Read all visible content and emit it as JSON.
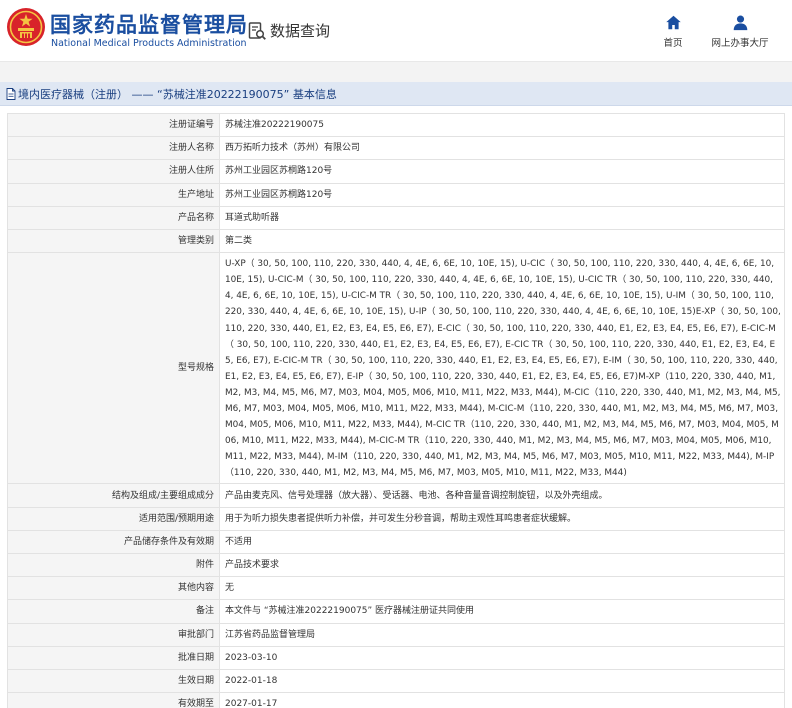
{
  "header": {
    "logo_cn": "国家药品监督管理局",
    "logo_en": "National Medical Products Administration",
    "emblem_icon": "national-emblem-icon",
    "query_label": "数据查询",
    "query_icon": "document-search-icon",
    "nav": [
      {
        "label": "首页",
        "icon": "home-icon"
      },
      {
        "label": "网上办事大厅",
        "icon": "user-icon"
      }
    ]
  },
  "title_bar": {
    "icon": "document-icon",
    "text": "境内医疗器械（注册） —— “苏械注准20222190075” 基本信息"
  },
  "colors": {
    "brand_blue": "#1a4ea0",
    "emblem_red": "#d8232a",
    "title_bar_bg": "#dfe7f3",
    "label_bg": "#f5f5f5"
  },
  "rows": [
    {
      "label": "注册证编号",
      "value": "苏械注准20222190075"
    },
    {
      "label": "注册人名称",
      "value": "西万拓听力技术（苏州）有限公司"
    },
    {
      "label": "注册人住所",
      "value": "苏州工业园区苏桐路120号"
    },
    {
      "label": "生产地址",
      "value": "苏州工业园区苏桐路120号"
    },
    {
      "label": "产品名称",
      "value": "耳道式助听器"
    },
    {
      "label": "管理类别",
      "value": "第二类"
    },
    {
      "label": "型号规格",
      "value": "U-XP（ 30, 50, 100, 110, 220, 330, 440, 4, 4E, 6, 6E, 10, 10E, 15), U-CIC（ 30, 50, 100, 110, 220, 330, 440, 4, 4E, 6, 6E, 10, 10E, 15), U-CIC-M（ 30, 50, 100, 110, 220, 330, 440, 4, 4E, 6, 6E, 10, 10E, 15), U-CIC TR（ 30, 50, 100, 110, 220, 330, 440, 4, 4E, 6, 6E, 10, 10E, 15), U-CIC-M TR（ 30, 50, 100, 110, 220, 330, 440, 4, 4E, 6, 6E, 10, 10E, 15), U-IM（ 30, 50, 100, 110, 220, 330, 440, 4, 4E, 6, 6E, 10, 10E, 15), U-IP（ 30, 50, 100, 110, 220, 330, 440, 4, 4E, 6, 6E, 10, 10E, 15)E-XP（ 30, 50, 100, 110, 220, 330, 440, E1, E2, E3, E4, E5, E6, E7), E-CIC（ 30, 50, 100, 110, 220, 330, 440, E1, E2, E3, E4, E5, E6, E7), E-CIC-M（ 30, 50, 100, 110, 220, 330, 440, E1, E2, E3, E4, E5, E6, E7), E-CIC TR（ 30, 50, 100, 110, 220, 330, 440, E1, E2, E3, E4, E5, E6, E7), E-CIC-M TR（ 30, 50, 100, 110, 220, 330, 440, E1, E2, E3, E4, E5, E6, E7), E-IM（ 30, 50, 100, 110, 220, 330, 440, E1, E2, E3, E4, E5, E6, E7), E-IP（ 30, 50, 100, 110, 220, 330, 440, E1, E2, E3, E4, E5, E6, E7)M-XP（110, 220, 330, 440, M1, M2, M3, M4, M5, M6, M7, M03, M04, M05, M06, M10, M11, M22, M33, M44), M-CIC（110, 220, 330, 440, M1, M2, M3, M4, M5, M6, M7, M03, M04, M05, M06, M10, M11, M22, M33, M44), M-CIC-M（110, 220, 330, 440, M1, M2, M3, M4, M5, M6, M7, M03, M04, M05, M06, M10, M11, M22, M33, M44), M-CIC TR（110, 220, 330, 440, M1, M2, M3, M4, M5, M6, M7, M03, M04, M05, M06, M10, M11, M22, M33, M44), M-CIC-M TR（110, 220, 330, 440, M1, M2, M3, M4, M5, M6, M7, M03, M04, M05, M06, M10, M11, M22, M33, M44), M-IM（110, 220, 330, 440, M1, M2, M3, M4, M5, M6, M7, M03, M05, M10, M11, M22, M33, M44), M-IP（110, 220, 330, 440, M1, M2, M3, M4, M5, M6, M7, M03, M05, M10, M11, M22, M33, M44)"
    },
    {
      "label": "结构及组成/主要组成成分",
      "value": "产品由麦克风、信号处理器（放大器）、受话器、电池、各种音量音调控制旋钮，以及外壳组成。"
    },
    {
      "label": "适用范围/预期用途",
      "value": "用于为听力损失患者提供听力补偿，并可发生分秒音调，帮助主观性耳鸣患者症状缓解。"
    },
    {
      "label": "产品储存条件及有效期",
      "value": "不适用"
    },
    {
      "label": "附件",
      "value": "产品技术要求"
    },
    {
      "label": "其他内容",
      "value": "无"
    },
    {
      "label": "备注",
      "value": "本文件与 “苏械注准20222190075” 医疗器械注册证共同使用"
    },
    {
      "label": "审批部门",
      "value": "江苏省药品监督管理局"
    },
    {
      "label": "批准日期",
      "value": "2023-03-10"
    },
    {
      "label": "生效日期",
      "value": "2022-01-18"
    },
    {
      "label": "有效期至",
      "value": "2027-01-17"
    }
  ]
}
